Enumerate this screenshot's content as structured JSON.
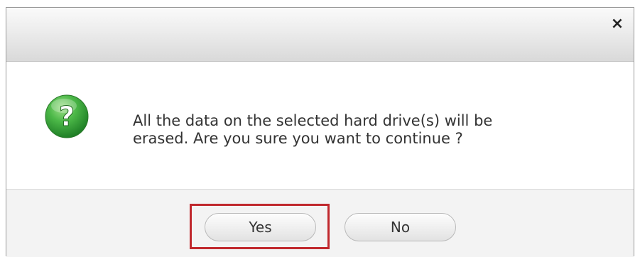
{
  "dialog": {
    "close_symbol": "×",
    "icon": "question-icon",
    "message_line1": "All the data on the selected hard drive(s) will be",
    "message_line2": "erased. Are you sure you want to continue ?",
    "buttons": {
      "yes_label": "Yes",
      "no_label": "No"
    }
  },
  "colors": {
    "icon_green": "#3aa53a",
    "highlight_red": "#c0282d",
    "footer_bg": "#f3f3f3"
  },
  "annotation": {
    "highlighted_button": "Yes"
  }
}
